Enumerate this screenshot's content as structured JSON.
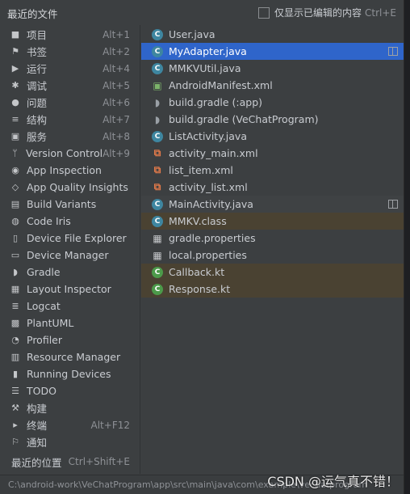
{
  "header": {
    "title": "最近的文件",
    "only_edited_label": "仅显示已编辑的内容",
    "only_edited_shortcut": "Ctrl+E"
  },
  "tool_windows": [
    {
      "label": "项目",
      "shortcut": "Alt+1",
      "icon": "folder-icon"
    },
    {
      "label": "书签",
      "shortcut": "Alt+2",
      "icon": "bookmark-icon"
    },
    {
      "label": "运行",
      "shortcut": "Alt+4",
      "icon": "run-icon"
    },
    {
      "label": "调试",
      "shortcut": "Alt+5",
      "icon": "debug-icon"
    },
    {
      "label": "问题",
      "shortcut": "Alt+6",
      "icon": "problems-icon"
    },
    {
      "label": "结构",
      "shortcut": "Alt+7",
      "icon": "structure-icon"
    },
    {
      "label": "服务",
      "shortcut": "Alt+8",
      "icon": "services-icon"
    },
    {
      "label": "Version Control",
      "shortcut": "Alt+9",
      "icon": "vcs-icon"
    },
    {
      "label": "App Inspection",
      "shortcut": "",
      "icon": "app-inspection-icon"
    },
    {
      "label": "App Quality Insights",
      "shortcut": "",
      "icon": "diamond-icon"
    },
    {
      "label": "Build Variants",
      "shortcut": "",
      "icon": "build-variants-icon"
    },
    {
      "label": "Code Iris",
      "shortcut": "",
      "icon": "code-iris-icon"
    },
    {
      "label": "Device File Explorer",
      "shortcut": "",
      "icon": "device-file-icon"
    },
    {
      "label": "Device Manager",
      "shortcut": "",
      "icon": "device-manager-icon"
    },
    {
      "label": "Gradle",
      "shortcut": "",
      "icon": "gradle-icon"
    },
    {
      "label": "Layout Inspector",
      "shortcut": "",
      "icon": "layout-inspector-icon"
    },
    {
      "label": "Logcat",
      "shortcut": "",
      "icon": "logcat-icon"
    },
    {
      "label": "PlantUML",
      "shortcut": "",
      "icon": "plantuml-icon"
    },
    {
      "label": "Profiler",
      "shortcut": "",
      "icon": "profiler-icon"
    },
    {
      "label": "Resource Manager",
      "shortcut": "",
      "icon": "resource-manager-icon"
    },
    {
      "label": "Running Devices",
      "shortcut": "",
      "icon": "running-devices-icon"
    },
    {
      "label": "TODO",
      "shortcut": "",
      "icon": "todo-icon"
    },
    {
      "label": "构建",
      "shortcut": "",
      "icon": "hammer-icon"
    },
    {
      "label": "终端",
      "shortcut": "Alt+F12",
      "icon": "terminal-icon"
    },
    {
      "label": "通知",
      "shortcut": "",
      "icon": "bell-icon"
    }
  ],
  "recent_locations": {
    "label": "最近的位置",
    "shortcut": "Ctrl+Shift+E"
  },
  "files": [
    {
      "name": "User.java",
      "type": "java",
      "state": "normal"
    },
    {
      "name": "MyAdapter.java",
      "type": "java",
      "state": "selected"
    },
    {
      "name": "MMKVUtil.java",
      "type": "java",
      "state": "normal"
    },
    {
      "name": "AndroidManifest.xml",
      "type": "manifest",
      "state": "normal"
    },
    {
      "name": "build.gradle (:app)",
      "type": "gradle",
      "state": "normal"
    },
    {
      "name": "build.gradle (VeChatProgram)",
      "type": "gradle",
      "state": "normal"
    },
    {
      "name": "ListActivity.java",
      "type": "java",
      "state": "normal"
    },
    {
      "name": "activity_main.xml",
      "type": "xml",
      "state": "normal"
    },
    {
      "name": "list_item.xml",
      "type": "xml",
      "state": "normal"
    },
    {
      "name": "activity_list.xml",
      "type": "xml",
      "state": "normal"
    },
    {
      "name": "MainActivity.java",
      "type": "java",
      "state": "highlight"
    },
    {
      "name": "MMKV.class",
      "type": "java",
      "state": "brown"
    },
    {
      "name": "gradle.properties",
      "type": "prop",
      "state": "normal"
    },
    {
      "name": "local.properties",
      "type": "prop",
      "state": "normal"
    },
    {
      "name": "Callback.kt",
      "type": "kt",
      "state": "brown"
    },
    {
      "name": "Response.kt",
      "type": "kt",
      "state": "brown"
    }
  ],
  "path": "C:\\android-work\\VeChatProgram\\app\\src\\main\\java\\com\\example\\vechatprogram",
  "watermark": "CSDN @运气真不错！",
  "colors": {
    "selection": "#2f65ca",
    "background": "#3c3f41",
    "java_icon": "#3e86a0",
    "kotlin_icon": "#4c9a4a",
    "xml_icon": "#e0794a"
  }
}
